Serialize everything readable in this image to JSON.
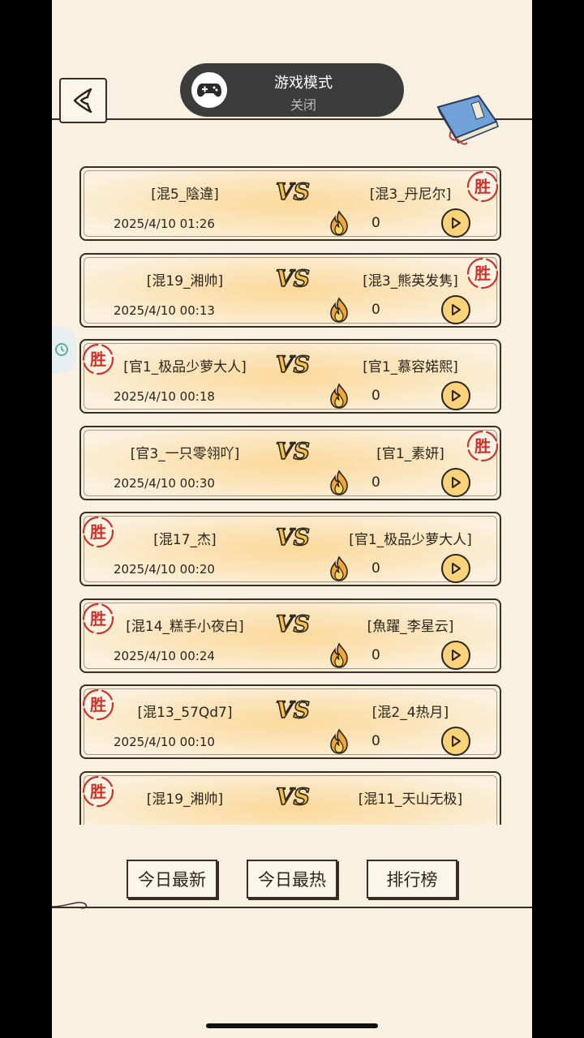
{
  "game_mode": {
    "title": "游戏模式",
    "status": "关闭",
    "icon": "gamepad-icon"
  },
  "header": {
    "back_icon": "back-chevron-icon",
    "book_icon": "scroll-book-icon"
  },
  "vs_text": "VS",
  "stamp_text": "胜",
  "matches": [
    {
      "left": "[混5_陰違]",
      "right": "[混3_丹尼尔]",
      "date": "2025/4/10 01:26",
      "heat": "0",
      "winner": "right"
    },
    {
      "left": "[混19_湘帅]",
      "right": "[混3_熊英发隽]",
      "date": "2025/4/10 00:13",
      "heat": "0",
      "winner": "right"
    },
    {
      "left": "[官1_极品少萝大人]",
      "right": "[官1_慕容婼熙]",
      "date": "2025/4/10 00:18",
      "heat": "0",
      "winner": "left"
    },
    {
      "left": "[官3_一只零翎吖]",
      "right": "[官1_素妍]",
      "date": "2025/4/10 00:30",
      "heat": "0",
      "winner": "right"
    },
    {
      "left": "[混17_杰]",
      "right": "[官1_极品少萝大人]",
      "date": "2025/4/10 00:20",
      "heat": "0",
      "winner": "left"
    },
    {
      "left": "[混14_糕手小夜白]",
      "right": "[魚躍_李星云]",
      "date": "2025/4/10 00:24",
      "heat": "0",
      "winner": "left"
    },
    {
      "left": "[混13_57Qd7]",
      "right": "[混2_4热月]",
      "date": "2025/4/10 00:10",
      "heat": "0",
      "winner": "left"
    },
    {
      "left": "[混19_湘帅]",
      "right": "[混11_天山无极]",
      "date": "",
      "heat": "",
      "winner": "left"
    }
  ],
  "tabs": {
    "latest": "今日最新",
    "hottest": "今日最热",
    "ranking": "排行榜"
  },
  "colors": {
    "paper": "#f8f1e2",
    "ink": "#3a2e24",
    "stamp": "#c8332b",
    "card_glow": "#fbd99b",
    "play": "#fbd37a"
  }
}
